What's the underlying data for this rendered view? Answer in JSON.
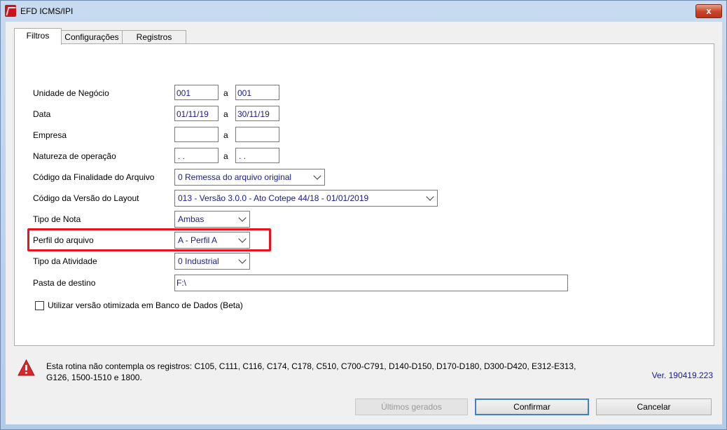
{
  "window": {
    "title": "EFD ICMS/IPI",
    "close_label": "x"
  },
  "tabs": [
    {
      "label": "Filtros"
    },
    {
      "label": "Configurações"
    },
    {
      "label": "Registros"
    }
  ],
  "form": {
    "range_separator": "a",
    "unidade_negocio": {
      "label": "Unidade de Negócio",
      "from": "001",
      "to": "001"
    },
    "data": {
      "label": "Data",
      "from": "01/11/19",
      "to": "30/11/19"
    },
    "empresa": {
      "label": "Empresa",
      "from": "",
      "to": ""
    },
    "natureza": {
      "label": "Natureza de operação",
      "from": ". .",
      "to": ". ."
    },
    "finalidade": {
      "label": "Código da Finalidade do Arquivo",
      "value": "0 Remessa do arquivo original"
    },
    "versao_layout": {
      "label": "Código da Versão do Layout",
      "value": "013 - Versão 3.0.0 - Ato Cotepe 44/18 - 01/01/2019"
    },
    "tipo_nota": {
      "label": "Tipo de Nota",
      "value": "Ambas"
    },
    "perfil": {
      "label": "Perfil do arquivo",
      "value": "A - Perfil A"
    },
    "tipo_atividade": {
      "label": "Tipo da Atividade",
      "value": "0 Industrial"
    },
    "pasta_destino": {
      "label": "Pasta de destino",
      "value": "F:\\"
    },
    "otimizada": {
      "label": "Utilizar versão otimizada em Banco de Dados (Beta)",
      "checked": false
    }
  },
  "footer": {
    "message_line1": "Esta rotina não contempla os registros: C105, C111, C116, C174, C178, C510, C700-C791, D140-D150, D170-D180, D300-D420, E312-E313,",
    "message_line2": "G126, 1500-1510 e 1800.",
    "version": "Ver. 190419.223",
    "buttons": {
      "ultimos": "Últimos gerados",
      "confirmar": "Confirmar",
      "cancelar": "Cancelar"
    }
  },
  "colors": {
    "highlight": "#e8141c",
    "value_text": "#1a1a8c",
    "warning": "#d9262b"
  }
}
